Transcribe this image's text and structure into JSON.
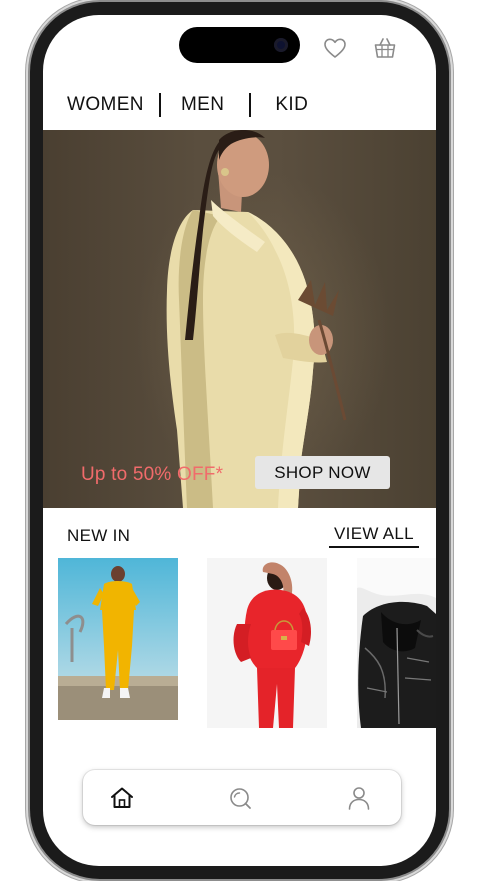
{
  "nav": {
    "categories": [
      "WOMEN",
      "MEN",
      "KID"
    ]
  },
  "header_icons": {
    "wishlist": "heart-icon",
    "cart": "basket-icon"
  },
  "hero": {
    "promo_text": "Up to 50% OFF*",
    "cta_label": "SHOP NOW"
  },
  "new_in": {
    "title": "NEW IN",
    "view_all_label": "VIEW ALL"
  },
  "bottom_nav": {
    "items": [
      "home-icon",
      "search-icon",
      "profile-icon"
    ]
  },
  "colors": {
    "promo": "#f16b6b",
    "cta_bg": "#e6e6e6",
    "text": "#111111"
  }
}
